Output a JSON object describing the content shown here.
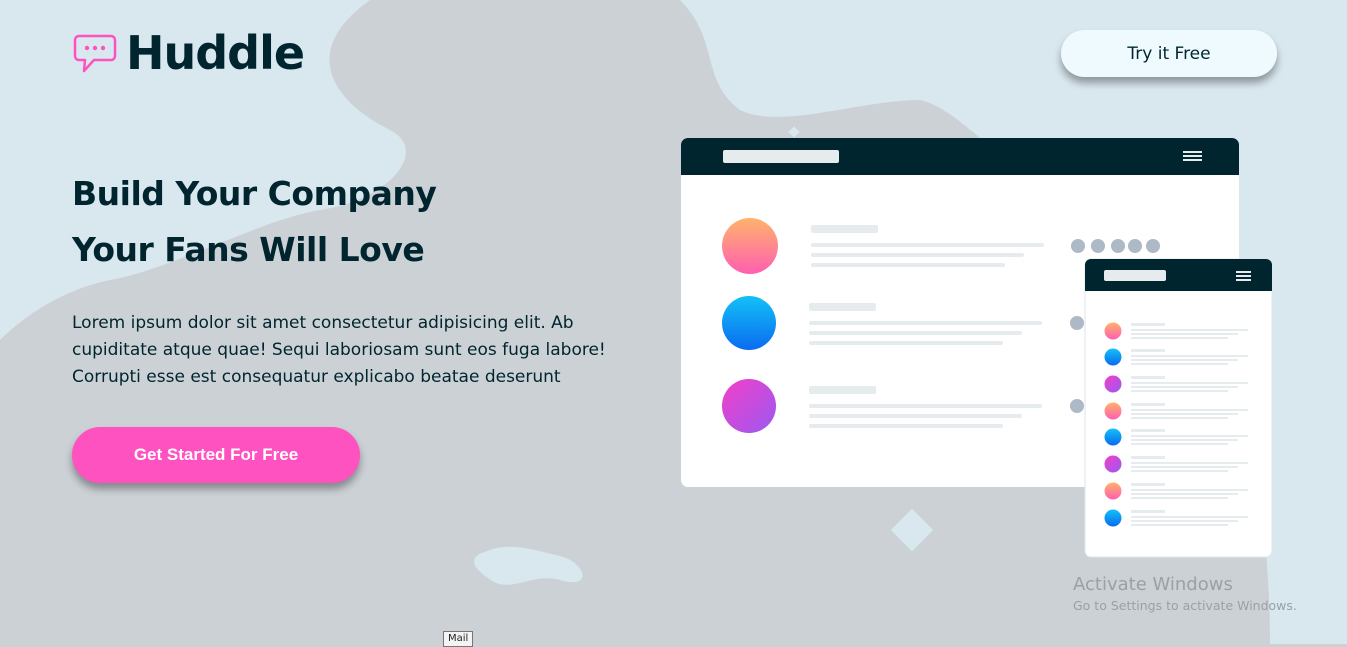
{
  "header": {
    "logo_text": "Huddle",
    "logo_icon": "chat-bubble-icon",
    "try_button_label": "Try it Free"
  },
  "hero": {
    "headline_line1": "Build Your Company",
    "headline_line2": "Your Fans Will Love",
    "description": "Lorem ipsum dolor sit amet consectetur adipisicing elit. Ab cupiditate atque quae! Sequi laboriosam sunt eos fuga labore! Corrupti esse est consequatur explicabo beatae deserunt",
    "cta_label": "Get Started For Free"
  },
  "watermark": {
    "title": "Activate Windows",
    "subtitle": "Go to Settings to activate Windows."
  },
  "tooltip": {
    "text": "Mail"
  },
  "colors": {
    "background": "#ccd1d6",
    "dark_text": "#00252e",
    "accent_pink": "#ff52c1",
    "try_button_bg": "#eefafe",
    "blob_light": "#d9e7ef"
  }
}
